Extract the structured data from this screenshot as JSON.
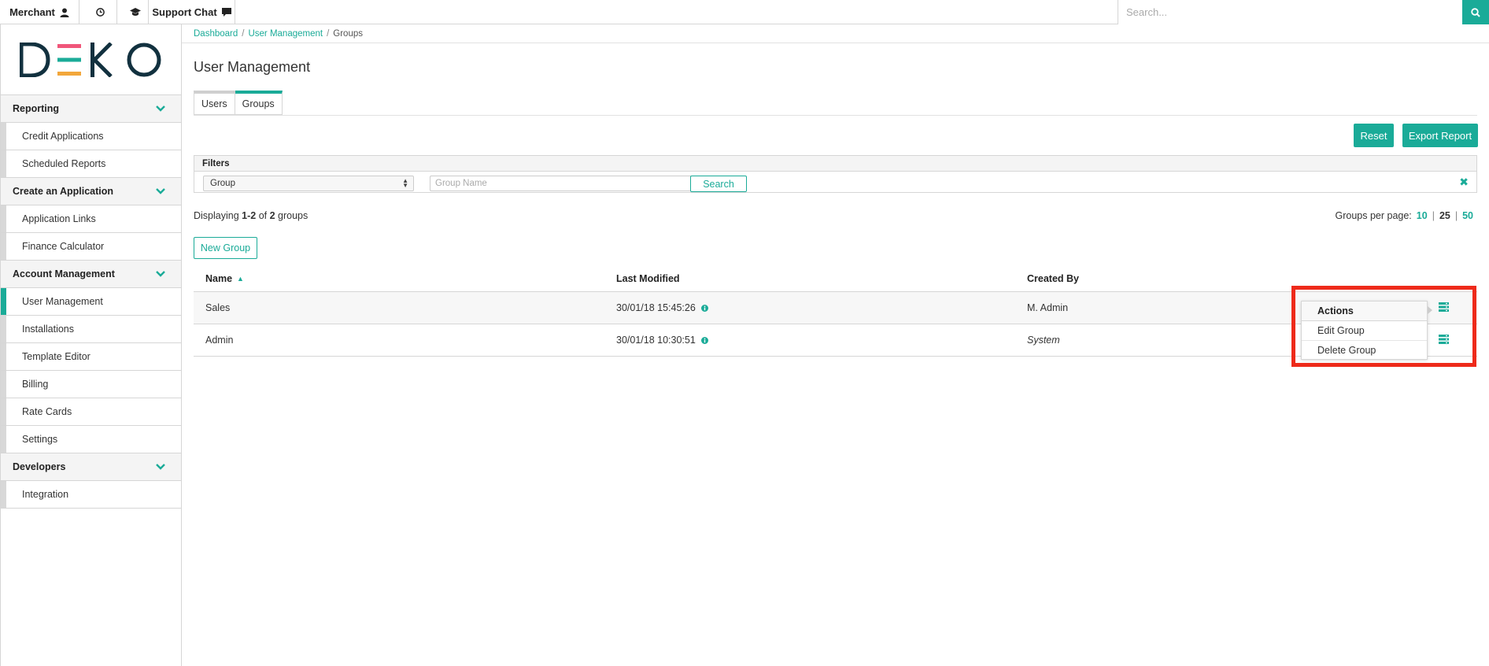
{
  "topbar": {
    "merchant_label": "Merchant",
    "support_label": "Support Chat",
    "search_placeholder": "Search...",
    "icons": [
      "user-icon",
      "clock-icon",
      "graduation-cap-icon",
      "chat-bubble-icon",
      "search-icon"
    ]
  },
  "brand": {
    "logo_text": "DEKO",
    "accent": "#1aab98",
    "logo_bar_colors": [
      "#f0567a",
      "#1aab98",
      "#f2a73b"
    ]
  },
  "sidebar": {
    "sections": [
      {
        "label": "Reporting",
        "items": [
          "Credit Applications",
          "Scheduled Reports"
        ]
      },
      {
        "label": "Create an Application",
        "items": [
          "Application Links",
          "Finance Calculator"
        ]
      },
      {
        "label": "Account Management",
        "items": [
          "User Management",
          "Installations",
          "Template Editor",
          "Billing",
          "Rate Cards",
          "Settings"
        ]
      },
      {
        "label": "Developers",
        "items": [
          "Integration"
        ]
      }
    ],
    "active_item": "User Management"
  },
  "breadcrumb": {
    "items": [
      "Dashboard",
      "User Management"
    ],
    "current": "Groups",
    "separator": "/"
  },
  "page": {
    "title": "User Management"
  },
  "tabs": [
    {
      "label": "Users",
      "active": false
    },
    {
      "label": "Groups",
      "active": true
    }
  ],
  "buttons": {
    "reset": "Reset",
    "export": "Export Report",
    "new_group": "New Group"
  },
  "filters": {
    "heading": "Filters",
    "select_value": "Group",
    "name_placeholder": "Group Name",
    "search_label": "Search",
    "clear_symbol": "✖"
  },
  "listing": {
    "displaying_prefix": "Displaying ",
    "range": "1-2",
    "of_text": " of ",
    "total": "2",
    "unit": " groups",
    "per_page_label": "Groups per page:",
    "per_page_options": [
      "10",
      "25",
      "50"
    ],
    "per_page_current": "25"
  },
  "table": {
    "columns": [
      "Name",
      "Last Modified",
      "Created By"
    ],
    "rows": [
      {
        "name": "Sales",
        "last_modified": "30/01/18 15:45:26",
        "created_by": "M. Admin",
        "created_by_italic": false
      },
      {
        "name": "Admin",
        "last_modified": "30/01/18 10:30:51",
        "created_by": "System",
        "created_by_italic": true
      }
    ]
  },
  "actions_menu": {
    "heading": "Actions",
    "items": [
      "Edit Group",
      "Delete Group"
    ]
  },
  "highlight_color": "#ee2a1a"
}
